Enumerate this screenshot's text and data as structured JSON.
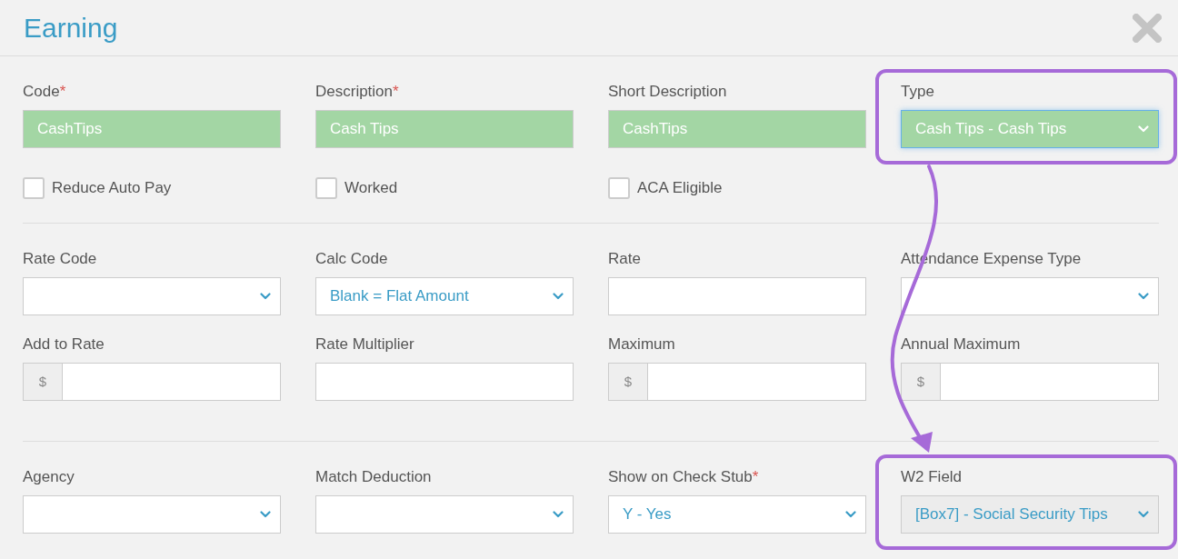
{
  "dialog": {
    "title": "Earning"
  },
  "sections": [
    {
      "rows": [
        [
          {
            "kind": "text",
            "label": "Code",
            "required_mark": "*",
            "value": "CashTips",
            "filled": true,
            "focused": false,
            "disabled": false,
            "highlighted": false
          },
          {
            "kind": "text",
            "label": "Description",
            "required_mark": "*",
            "value": "Cash Tips",
            "filled": true,
            "focused": false,
            "disabled": false,
            "highlighted": false
          },
          {
            "kind": "text",
            "label": "Short Description",
            "value": "CashTips",
            "filled": true,
            "focused": false,
            "disabled": false,
            "highlighted": false
          },
          {
            "kind": "select",
            "label": "Type",
            "value": "Cash Tips - Cash Tips",
            "filled": true,
            "focused": true,
            "disabled": false,
            "highlighted": true
          }
        ],
        [
          {
            "kind": "checkbox",
            "label": "Reduce Auto Pay",
            "checked": false
          },
          {
            "kind": "checkbox",
            "label": "Worked",
            "checked": false
          },
          {
            "kind": "checkbox",
            "label": "ACA Eligible",
            "checked": false
          }
        ]
      ]
    },
    {
      "rows": [
        [
          {
            "kind": "select",
            "label": "Rate Code",
            "filled": false,
            "focused": false,
            "disabled": false,
            "highlighted": false
          },
          {
            "kind": "select",
            "label": "Calc Code",
            "value": "Blank = Flat Amount",
            "filled": false,
            "focused": false,
            "disabled": false,
            "highlighted": false
          },
          {
            "kind": "text",
            "label": "Rate",
            "filled": false,
            "focused": false,
            "disabled": false,
            "highlighted": false
          },
          {
            "kind": "select",
            "label": "Attendance Expense Type",
            "filled": false,
            "focused": false,
            "disabled": false,
            "highlighted": false
          }
        ],
        [
          {
            "kind": "money",
            "label": "Add to Rate",
            "prefix": "$",
            "filled": false,
            "focused": false,
            "disabled": false,
            "highlighted": false
          },
          {
            "kind": "text",
            "label": "Rate Multiplier",
            "filled": false,
            "focused": false,
            "disabled": false,
            "highlighted": false
          },
          {
            "kind": "money",
            "label": "Maximum",
            "prefix": "$",
            "filled": false,
            "focused": false,
            "disabled": false,
            "highlighted": false
          },
          {
            "kind": "money",
            "label": "Annual Maximum",
            "prefix": "$",
            "filled": false,
            "focused": false,
            "disabled": false,
            "highlighted": false
          }
        ]
      ]
    },
    {
      "rows": [
        [
          {
            "kind": "select",
            "label": "Agency",
            "filled": false,
            "focused": false,
            "disabled": false,
            "highlighted": false
          },
          {
            "kind": "select",
            "label": "Match Deduction",
            "filled": false,
            "focused": false,
            "disabled": false,
            "highlighted": false
          },
          {
            "kind": "select",
            "label": "Show on Check Stub",
            "required_mark": "*",
            "value": "Y - Yes",
            "filled": false,
            "focused": false,
            "disabled": false,
            "highlighted": false
          },
          {
            "kind": "select",
            "label": "W2 Field",
            "value": "[Box7] - Social Security Tips",
            "filled": false,
            "focused": false,
            "disabled": true,
            "highlighted": true
          }
        ]
      ]
    }
  ]
}
